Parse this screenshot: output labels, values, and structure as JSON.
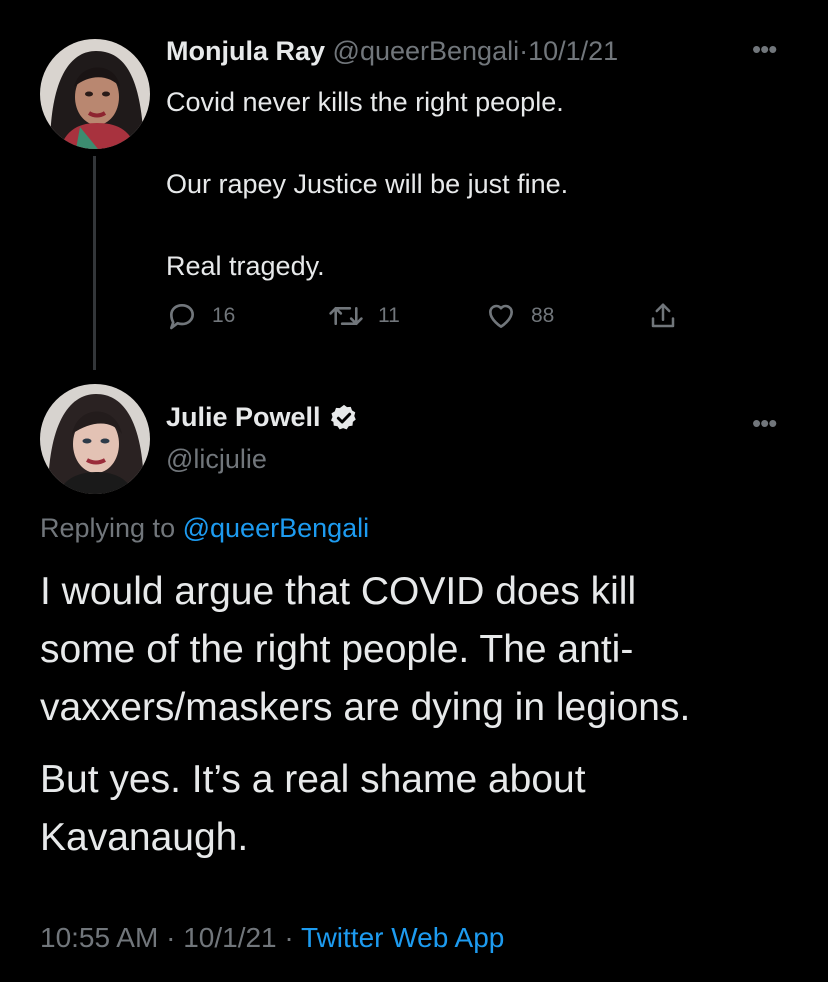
{
  "tweet1": {
    "name": "Monjula Ray",
    "handle": "@queerBengali",
    "separator": "·",
    "date": "10/1/21",
    "lines": [
      "Covid never kills the right people.",
      "Our rapey Justice will be just fine.",
      "Real tragedy."
    ],
    "stats": {
      "replies": "16",
      "retweets": "11",
      "likes": "88"
    },
    "more_icon": "more-horizontal-icon"
  },
  "tweet2": {
    "name": "Julie Powell",
    "handle": "@licjulie",
    "verified_icon": "verified-badge-icon",
    "replying_label": "Replying to",
    "replying_handle": "@queerBengali",
    "paragraph1_lines": [
      "I would argue that COVID does kill",
      "some of the right people. The anti-",
      "vaxxers/maskers are dying in legions."
    ],
    "paragraph2_lines": [
      "But yes. It’s a real shame about",
      "Kavanaugh."
    ],
    "time": "10:55 AM",
    "separator": "·",
    "date": "10/1/21",
    "source": "Twitter Web App",
    "more_icon": "more-horizontal-icon"
  },
  "colors": {
    "background": "#000000",
    "text": "#e7e9ea",
    "muted": "#71767b",
    "link": "#1d9bf0",
    "thread_line": "#333639"
  }
}
